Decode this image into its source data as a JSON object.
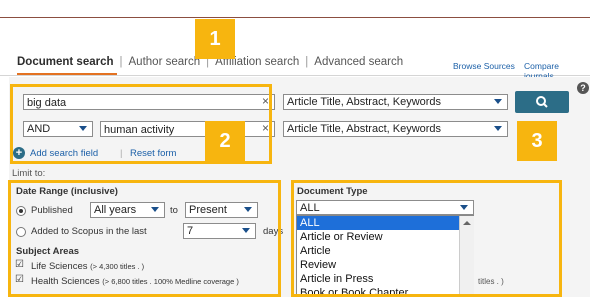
{
  "tabs": {
    "document_search": "Document search",
    "author_search": "Author search",
    "affiliation_search": "Affiliation search",
    "advanced_search": "Advanced search"
  },
  "top_links": {
    "browse_sources": "Browse Sources",
    "compare_journals": "Compare journals"
  },
  "search_rows": [
    {
      "value": "big data",
      "field": "Article Title, Abstract, Keywords"
    },
    {
      "operator": "AND",
      "value": "human activity",
      "field": "Article Title, Abstract, Keywords"
    }
  ],
  "add_search_field": "Add search field",
  "reset_form": "Reset form",
  "limit_to": "Limit to:",
  "date_range": {
    "heading": "Date Range (inclusive)",
    "published_label": "Published",
    "from_value": "All years",
    "to_label": "to",
    "to_value": "Present",
    "added_label": "Added to Scopus in the last",
    "days_value": "7",
    "days_label": "days"
  },
  "subject_areas": {
    "heading": "Subject Areas",
    "items": [
      {
        "label": "Life Sciences",
        "note": "(> 4,300 titles . )"
      },
      {
        "label": "Health Sciences",
        "note": "(> 6,800 titles . 100% Medline coverage )"
      }
    ]
  },
  "document_type": {
    "heading": "Document Type",
    "selected": "ALL",
    "options": [
      "ALL",
      "Article or Review",
      "Article",
      "Review",
      "Article in Press",
      "Book or Book Chapter"
    ],
    "hidden_note": "titles . )"
  },
  "annotations": [
    "1",
    "2",
    "3"
  ],
  "colors": {
    "annotation": "#f7b50f",
    "accent_tab": "#e37222",
    "search_button": "#2c6d87",
    "selected_option": "#1e6fd9"
  }
}
